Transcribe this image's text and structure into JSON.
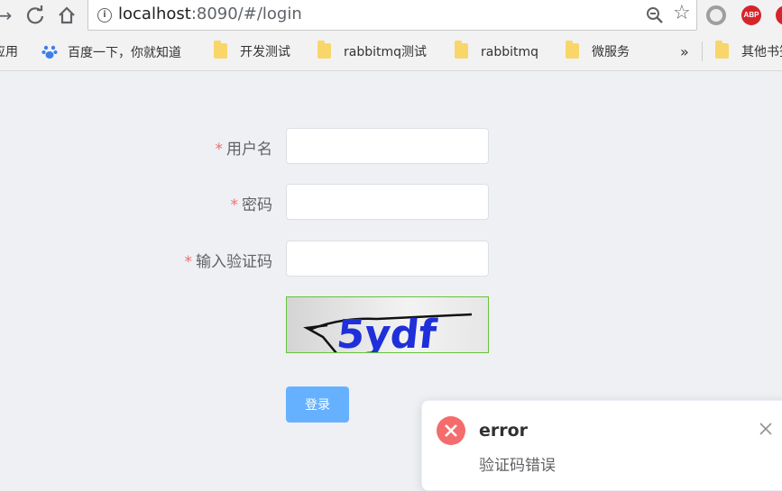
{
  "browser": {
    "url_host": "localhost",
    "url_rest": ":8090/#/login",
    "abp_label": "ABP"
  },
  "bookmarks": [
    "应用",
    "百度一下，你就知道",
    "开发测试",
    "rabbitmq测试",
    "rabbitmq",
    "微服务",
    "»",
    "其他书签"
  ],
  "form": {
    "username_label": "用户名",
    "password_label": "密码",
    "captcha_label": "输入验证码",
    "required_mark": "*",
    "captcha_text": "5ydf",
    "login_button": "登录"
  },
  "notification": {
    "title": "error",
    "message": "验证码错误"
  },
  "colors": {
    "required": "#f56c6c",
    "button": "#66b1ff",
    "error_icon": "#f56c6c",
    "captcha_border": "#67c23a"
  }
}
